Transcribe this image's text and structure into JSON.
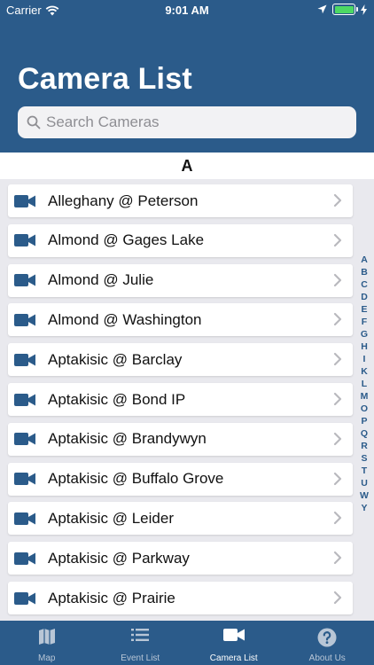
{
  "status_bar": {
    "carrier": "Carrier",
    "time": "9:01 AM"
  },
  "header": {
    "title": "Camera List"
  },
  "search": {
    "placeholder": "Search Cameras",
    "value": ""
  },
  "section": {
    "letter": "A"
  },
  "cameras": [
    {
      "label": "Alleghany @ Peterson"
    },
    {
      "label": "Almond @ Gages Lake"
    },
    {
      "label": "Almond @ Julie"
    },
    {
      "label": "Almond @ Washington"
    },
    {
      "label": "Aptakisic @ Barclay"
    },
    {
      "label": "Aptakisic @ Bond IP"
    },
    {
      "label": "Aptakisic @ Brandywyn"
    },
    {
      "label": "Aptakisic @ Buffalo Grove"
    },
    {
      "label": "Aptakisic @ Leider"
    },
    {
      "label": "Aptakisic @ Parkway"
    },
    {
      "label": "Aptakisic @ Prairie"
    }
  ],
  "index_letters": [
    "A",
    "B",
    "C",
    "D",
    "E",
    "F",
    "G",
    "H",
    "I",
    "K",
    "L",
    "M",
    "O",
    "P",
    "Q",
    "R",
    "S",
    "T",
    "U",
    "W",
    "Y"
  ],
  "tabs": [
    {
      "label": "Map",
      "icon": "map-icon",
      "active": false
    },
    {
      "label": "Event List",
      "icon": "list-icon",
      "active": false
    },
    {
      "label": "Camera List",
      "icon": "video-camera-icon",
      "active": true
    },
    {
      "label": "About Us",
      "icon": "help-icon",
      "active": false
    }
  ],
  "colors": {
    "brand": "#2b5b8a",
    "battery": "#4cd964",
    "tab_inactive": "#b8c6d6"
  }
}
